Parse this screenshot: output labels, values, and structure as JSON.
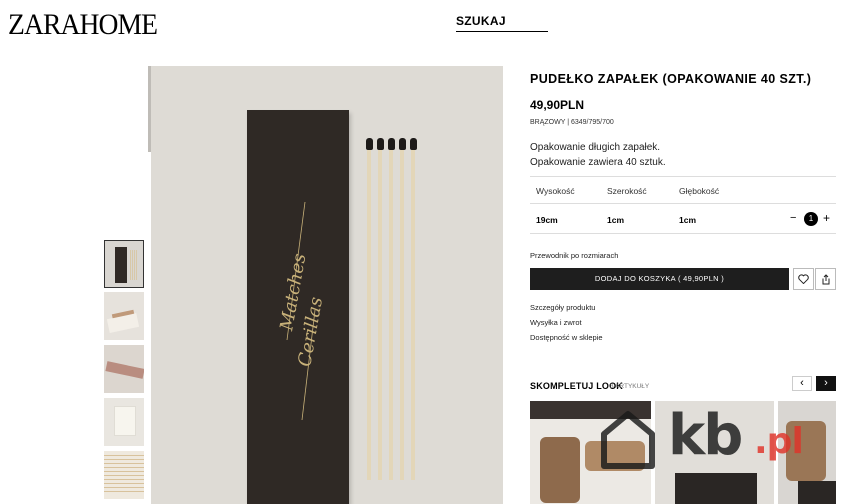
{
  "header": {
    "logo": "ZARAHOME",
    "search_label": "SZUKAJ"
  },
  "product": {
    "title": "PUDEŁKO ZAPAŁEK (OPAKOWANIE 40 SZT.)",
    "price": "49,90PLN",
    "color": "BRĄZOWY",
    "ref": "6349/795/700",
    "description": [
      "Opakowanie długich zapałek.",
      "Opakowanie zawiera 40 sztuk."
    ],
    "box_text": [
      "Matches",
      "Cerillas"
    ],
    "dimensions": {
      "headers": [
        "Wysokość",
        "Szerokość",
        "Głębokość"
      ],
      "values": [
        "19cm",
        "1cm",
        "1cm"
      ]
    },
    "quantity": "1",
    "minus": "−",
    "plus": "+",
    "size_guide": "Przewodnik po rozmiarach",
    "add_to_cart": "DODAJ DO KOSZYKA ( 49,90PLN )",
    "links": [
      "Szczegóły produktu",
      "Wysyłka i zwrot",
      "Dostępność w sklepie"
    ]
  },
  "complete_look": {
    "title": "SKOMPLETUJ LOOK",
    "count": "3 ARTYKUŁY",
    "prev": "‹",
    "next": "›"
  },
  "watermark": {
    "main": "kb",
    "suffix": ".pl"
  },
  "icons": {
    "heart": "heart-icon",
    "share": "share-icon",
    "watermark_house": "house-icon"
  }
}
